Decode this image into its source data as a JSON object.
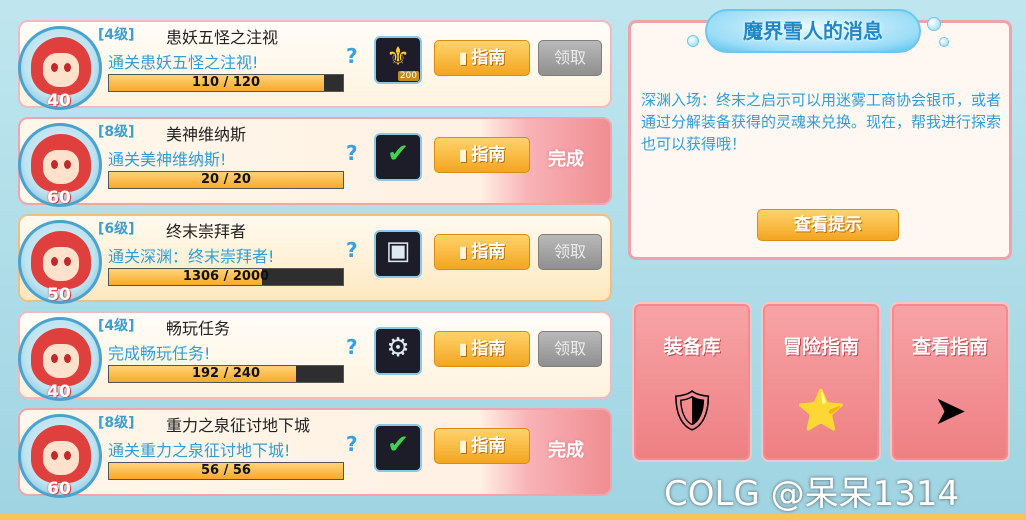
{
  "panel_title": "魔界雪人的消息",
  "message_text": "深渊入场：终末之启示可以用迷雾工商协会银币，或者通过分解装备获得的灵魂来兑换。现在，帮我进行探索也可以获得哦！",
  "hint_button": "查看提示",
  "guide_label": "指南",
  "claim_label": "领取",
  "done_label": "完成",
  "help_glyph": "?",
  "quests": [
    {
      "grade": "[4级]",
      "title": "患妖五怪之注视",
      "desc": "通关患妖五怪之注视!",
      "progress_text": "110 / 120",
      "progress": 0.917,
      "avatar_level": "40",
      "status": "claim",
      "icon": "gold-coin-icon",
      "icon_glyph": "⚜",
      "icon_tag": "200"
    },
    {
      "grade": "[8级]",
      "title": "美神维纳斯",
      "desc": "通关美神维纳斯!",
      "progress_text": "20 / 20",
      "progress": 1.0,
      "avatar_level": "60",
      "status": "done",
      "icon": "checkmark-icon",
      "icon_glyph": "✔",
      "icon_tag": ""
    },
    {
      "grade": "[6级]",
      "title": "终末崇拜者",
      "desc": "通关深渊：终末崇拜者!",
      "progress_text": "1306 / 2000",
      "progress": 0.653,
      "avatar_level": "50",
      "status": "claim",
      "icon": "treasure-chest-icon",
      "icon_glyph": "▣",
      "icon_tag": ""
    },
    {
      "grade": "[4级]",
      "title": "畅玩任务",
      "desc": "完成畅玩任务!",
      "progress_text": "192 / 240",
      "progress": 0.8,
      "avatar_level": "40",
      "status": "claim",
      "icon": "gear-token-icon",
      "icon_glyph": "⚙",
      "icon_tag": ""
    },
    {
      "grade": "[8级]",
      "title": "重力之泉征讨地下城",
      "desc": "通关重力之泉征讨地下城!",
      "progress_text": "56 / 56",
      "progress": 1.0,
      "avatar_level": "60",
      "status": "done",
      "icon": "checkmark-icon",
      "icon_glyph": "✔",
      "icon_tag": ""
    }
  ],
  "big_buttons": [
    {
      "label": "装备库",
      "icon": "armor-icon",
      "glyph": "🛡"
    },
    {
      "label": "冒险指南",
      "icon": "star-book-icon",
      "glyph": "⭐"
    },
    {
      "label": "查看指南",
      "icon": "signpost-icon",
      "glyph": "➤"
    }
  ],
  "watermark": "COLG @呆呆1314",
  "colors": {
    "accent_blue": "#2f9fd8",
    "guide_orange": "#f3a520",
    "done_pink": "#ee7f83"
  }
}
